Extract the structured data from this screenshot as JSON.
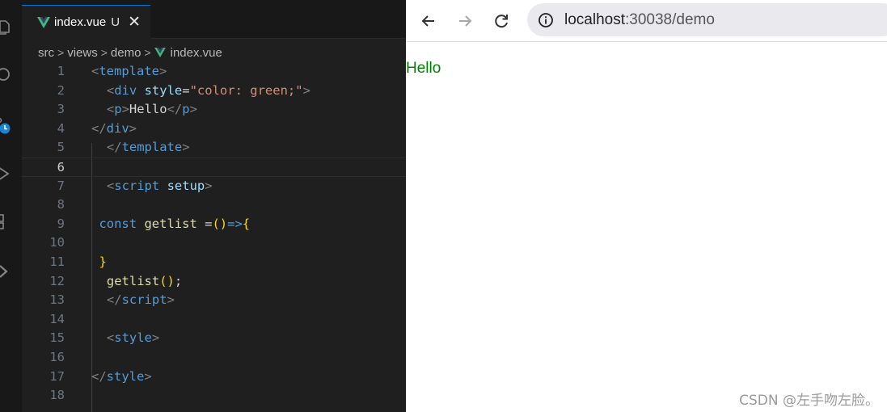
{
  "editor": {
    "tab": {
      "label": "index.vue",
      "status": "U",
      "close": "✕"
    },
    "breadcrumb": [
      "src",
      "views",
      "demo",
      "index.vue"
    ],
    "activity_icons": [
      "explorer-icon",
      "search-icon",
      "source-control-icon",
      "run-debug-icon",
      "extensions-icon",
      "remote-icon"
    ],
    "current_line": 6,
    "lines": [
      {
        "n": "1",
        "tokens": [
          [
            "tg",
            "<"
          ],
          [
            "tn",
            "template"
          ],
          [
            "tg",
            ">"
          ]
        ],
        "indent": 0
      },
      {
        "n": "2",
        "tokens": [
          [
            "tg",
            "<"
          ],
          [
            "tn",
            "div"
          ],
          [
            "pl",
            " "
          ],
          [
            "at",
            "style"
          ],
          [
            "pl",
            "="
          ],
          [
            "st",
            "\"color: "
          ],
          [
            "st",
            "green"
          ],
          [
            "st",
            ";\""
          ],
          [
            "tg",
            ">"
          ]
        ],
        "indent": 1
      },
      {
        "n": "3",
        "tokens": [
          [
            "tg",
            "<"
          ],
          [
            "tn",
            "p"
          ],
          [
            "tg",
            ">"
          ],
          [
            "pl",
            "Hello"
          ],
          [
            "tg",
            "</"
          ],
          [
            "tn",
            "p"
          ],
          [
            "tg",
            ">"
          ]
        ],
        "indent": 1
      },
      {
        "n": "4",
        "tokens": [
          [
            "tg",
            "</"
          ],
          [
            "tn",
            "div"
          ],
          [
            "tg",
            ">"
          ]
        ],
        "indent": 0
      },
      {
        "n": "5",
        "tokens": [
          [
            "tg",
            "</"
          ],
          [
            "tn",
            "template"
          ],
          [
            "tg",
            ">"
          ]
        ],
        "indent": 1
      },
      {
        "n": "6",
        "tokens": [],
        "indent": 0
      },
      {
        "n": "7",
        "tokens": [
          [
            "tg",
            "<"
          ],
          [
            "tn",
            "script"
          ],
          [
            "pl",
            " "
          ],
          [
            "at",
            "setup"
          ],
          [
            "tg",
            ">"
          ]
        ],
        "indent": 1
      },
      {
        "n": "8",
        "tokens": [],
        "indent": 0
      },
      {
        "n": "9",
        "tokens": [
          [
            "kw",
            "const"
          ],
          [
            "pl",
            " "
          ],
          [
            "fn",
            "getlist"
          ],
          [
            "pl",
            " ="
          ],
          [
            "br",
            "()"
          ],
          [
            "kw",
            "=>"
          ],
          [
            "br",
            "{"
          ]
        ],
        "indent": 0.5
      },
      {
        "n": "10",
        "tokens": [],
        "indent": 0
      },
      {
        "n": "11",
        "tokens": [
          [
            "br",
            "}"
          ]
        ],
        "indent": 0.5
      },
      {
        "n": "12",
        "tokens": [
          [
            "fn",
            "getlist"
          ],
          [
            "br",
            "()"
          ],
          [
            "pl",
            ";"
          ]
        ],
        "indent": 1
      },
      {
        "n": "13",
        "tokens": [
          [
            "tg",
            "</"
          ],
          [
            "tn",
            "script"
          ],
          [
            "tg",
            ">"
          ]
        ],
        "indent": 1
      },
      {
        "n": "14",
        "tokens": [],
        "indent": 0
      },
      {
        "n": "15",
        "tokens": [
          [
            "tg",
            "<"
          ],
          [
            "tn",
            "style"
          ],
          [
            "tg",
            ">"
          ]
        ],
        "indent": 1
      },
      {
        "n": "16",
        "tokens": [],
        "indent": 0
      },
      {
        "n": "17",
        "tokens": [
          [
            "tg",
            "</"
          ],
          [
            "tn",
            "style"
          ],
          [
            "tg",
            ">"
          ]
        ],
        "indent": 0
      },
      {
        "n": "18",
        "tokens": [],
        "indent": 0
      }
    ]
  },
  "browser": {
    "url_host": "localhost",
    "url_rest": ":30038/demo",
    "page_text": "Hello",
    "page_text_color": "#008000",
    "watermark": "CSDN @左手吻左脸。"
  },
  "colors": {
    "vue_green": "#41b883",
    "accent": "#0078d4"
  }
}
